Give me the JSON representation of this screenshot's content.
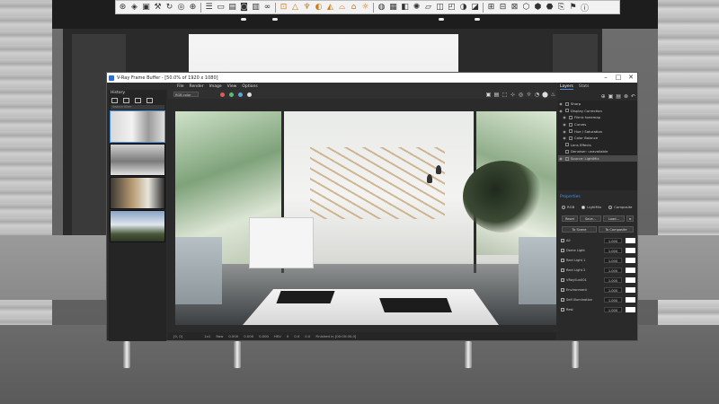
{
  "toolbar": {
    "icons": [
      "rings-icon",
      "select-icon",
      "box-icon",
      "wrench-icon",
      "rotate-icon",
      "render-icon",
      "plus-icon",
      "settings-icon",
      "window-icon",
      "layers-icon",
      "camera-icon",
      "film-icon",
      "link-icon",
      "frame-icon",
      "warning-icon",
      "light-icon",
      "hdr-icon",
      "spot-icon",
      "dome-icon",
      "ies-icon",
      "sun-icon",
      "sphere-icon",
      "mesh-icon",
      "proxy-icon",
      "fur-icon",
      "plane-icon",
      "cube-icon",
      "scene-icon",
      "mirror-icon",
      "clip-icon",
      "grid-icon",
      "export-icon",
      "vfb-icon",
      "cube2-icon",
      "cube3-icon",
      "cube4-icon",
      "import-icon",
      "flag-icon",
      "info-icon"
    ]
  },
  "vfb": {
    "title": "V-Ray Frame Buffer - [50.0% of 1920 x 1080]",
    "menu": [
      "File",
      "Render",
      "Image",
      "View",
      "Options"
    ],
    "rgb_channel": "RGB color",
    "color_dots": [
      "#e05a5a",
      "#4fc36b",
      "#5aa7e0"
    ],
    "gallery": {
      "title": "History",
      "search_placeholder": "Search filter"
    },
    "layers": {
      "tabs": [
        "Layers",
        "Stats"
      ],
      "items": [
        {
          "label": "Sharp",
          "visible": true
        },
        {
          "label": "Display Correction",
          "visible": true
        },
        {
          "label": "Filmic tonemap",
          "visible": true
        },
        {
          "label": "Curves",
          "visible": true
        },
        {
          "label": "Hue / Saturation",
          "visible": true
        },
        {
          "label": "Color Balance",
          "visible": true
        },
        {
          "label": "Lens Effects",
          "visible": false
        },
        {
          "label": "Denoiser: unavailable",
          "visible": false
        },
        {
          "label": "Source: LightMix",
          "visible": true,
          "selected": true
        }
      ]
    },
    "properties": {
      "title": "Properties",
      "mode_rgb": "RGB",
      "mode_lightmix": "LightMix",
      "mode_composite": "Composite",
      "reset_label": "Reset",
      "save_label": "Save...",
      "load_label": "Load...",
      "to_scene_label": "To Scene",
      "to_composite_label": "To Composite",
      "lights": [
        {
          "name": "All",
          "value": "1.000"
        },
        {
          "name": "Dome Light",
          "value": "1.000"
        },
        {
          "name": "Rect Light 1",
          "value": "1.000"
        },
        {
          "name": "Rect Light 2",
          "value": "1.000"
        },
        {
          "name": "VRaySun001",
          "value": "1.000"
        },
        {
          "name": "Environment",
          "value": "1.000"
        },
        {
          "name": "Self Illumination",
          "value": "1.000"
        },
        {
          "name": "Rest",
          "value": "1.000"
        }
      ]
    },
    "status": {
      "coords": "[0, 0]",
      "scale": "1x1",
      "mode": "Raw",
      "r": "0.000",
      "g": "0.000",
      "b": "0.000",
      "format": "HSV",
      "h": "0",
      "s": "0.0",
      "v": "0.0",
      "message": "Finished in [00:00:00.0]"
    }
  }
}
